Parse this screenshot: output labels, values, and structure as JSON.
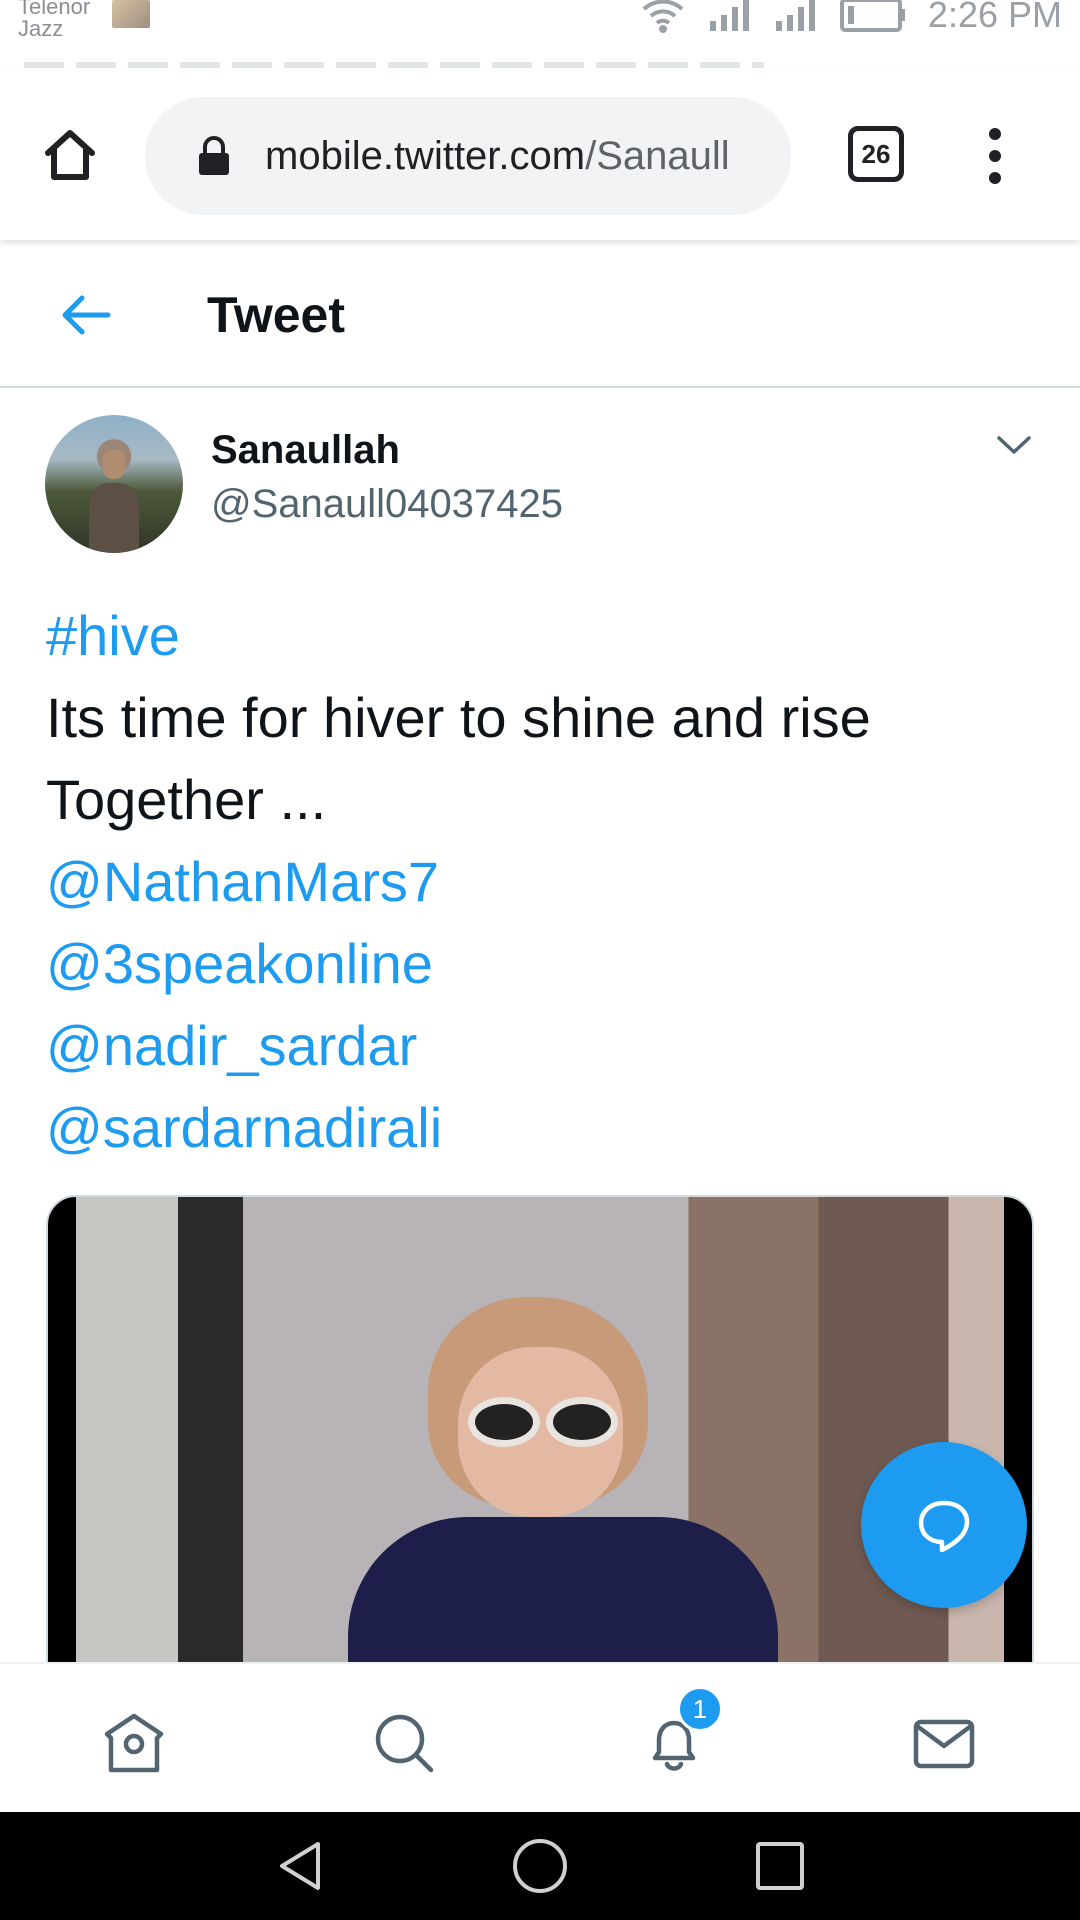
{
  "status_bar": {
    "carrier_line1": "Telenor",
    "carrier_line2": "Jazz",
    "time": "2:26 PM"
  },
  "browser": {
    "url_domain": "mobile.twitter.com",
    "url_path": "/Sanaull",
    "tab_count": "26"
  },
  "header": {
    "title": "Tweet"
  },
  "tweet": {
    "display_name": "Sanaullah",
    "handle": "@Sanaull04037425",
    "hashtag": "#hive",
    "text_line1": "Its time for hiver to shine and rise",
    "text_line2": "Together ...",
    "mentions": [
      "@NathanMars7",
      "@3speakonline",
      "@nadir_sardar",
      "@sardarnadirali"
    ]
  },
  "bottom_nav": {
    "items": [
      "home-icon",
      "search-icon",
      "notifications-icon",
      "messages-icon"
    ],
    "notification_count": "1"
  },
  "colors": {
    "accent": "#1d9bf0",
    "text_primary": "#0f1419",
    "text_secondary": "#536471"
  }
}
